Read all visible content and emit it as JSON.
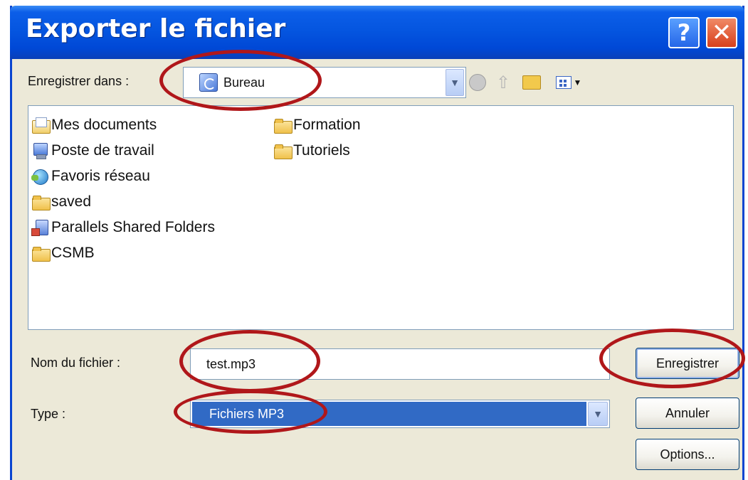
{
  "dialog": {
    "title": "Exporter le fichier",
    "help_label": "?",
    "close_label": "✕"
  },
  "save_in": {
    "label": "Enregistrer dans :",
    "value": "Bureau"
  },
  "files": [
    {
      "name": "Mes documents",
      "icon": "my-documents-icon"
    },
    {
      "name": "Poste de travail",
      "icon": "computer-icon"
    },
    {
      "name": "Favoris réseau",
      "icon": "network-icon"
    },
    {
      "name": "saved",
      "icon": "folder-icon"
    },
    {
      "name": "Parallels Shared Folders",
      "icon": "shared-folders-icon"
    },
    {
      "name": "CSMB",
      "icon": "folder-icon"
    },
    {
      "name": "Formation",
      "icon": "folder-icon"
    },
    {
      "name": "Tutoriels",
      "icon": "folder-icon"
    }
  ],
  "filename": {
    "label": "Nom du fichier :",
    "value": "test.mp3"
  },
  "type": {
    "label": "Type :",
    "selected": "Fichiers MP3"
  },
  "buttons": {
    "save": "Enregistrer",
    "cancel": "Annuler",
    "options": "Options..."
  },
  "colors": {
    "titlebar": "#0556e0",
    "annotation": "#b0171a",
    "selection": "#316ac5"
  }
}
